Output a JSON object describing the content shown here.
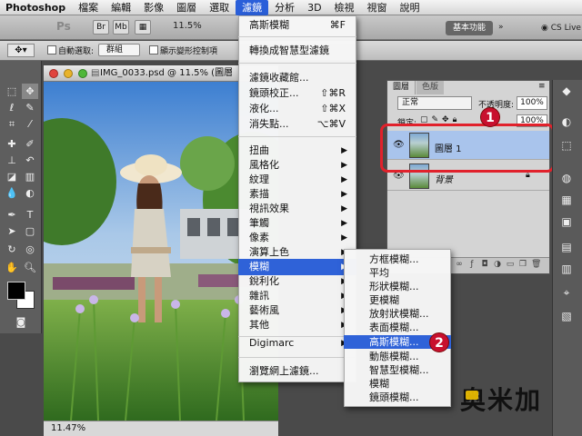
{
  "menubar": {
    "app_name": "Photoshop",
    "items": [
      "檔案",
      "編輯",
      "影像",
      "圖層",
      "選取",
      "濾鏡",
      "分析",
      "3D",
      "檢視",
      "視窗",
      "說明"
    ],
    "active": "濾鏡"
  },
  "appbar": {
    "ps_label": "Ps",
    "br_label": "Br",
    "mb_label": "Mb",
    "zoom": "11.5%",
    "workspace_label": "基本功能",
    "cslive_label": "CS Live"
  },
  "options": {
    "autoselect_label": "自動選取:",
    "group_value": "群組",
    "transform_label": "顯示變形控制項"
  },
  "document": {
    "title": "IMG_0033.psd @ 11.5% (圖層",
    "zoom_status": "11.47%"
  },
  "layers_panel": {
    "tabs": [
      "圖層",
      "色版"
    ],
    "blend_mode": "正常",
    "opacity_label": "不透明度:",
    "opacity_value": "100%",
    "lock_label": "鎖定:",
    "fill_value": "100%",
    "layers": [
      {
        "name": "圖層 1",
        "selected": true
      },
      {
        "name": "背景",
        "selected": false
      }
    ]
  },
  "filter_menu": {
    "top": [
      {
        "label": "高斯模糊",
        "shortcut": "⌘F"
      }
    ],
    "convert": "轉換成智慧型濾鏡",
    "group2": [
      {
        "label": "濾鏡收藏館...",
        "shortcut": ""
      },
      {
        "label": "鏡頭校正...",
        "shortcut": "⇧⌘R"
      },
      {
        "label": "液化...",
        "shortcut": "⇧⌘X"
      },
      {
        "label": "消失點...",
        "shortcut": "⌥⌘V"
      }
    ],
    "submenus": [
      "扭曲",
      "風格化",
      "紋理",
      "素描",
      "視訊效果",
      "筆觸",
      "像素",
      "演算上色",
      "模糊",
      "銳利化",
      "雜訊",
      "藝術風",
      "其他"
    ],
    "highlighted": "模糊",
    "digimarc": "Digimarc",
    "browse": "瀏覽網上濾鏡..."
  },
  "blur_submenu": {
    "items": [
      "方框模糊...",
      "平均",
      "形狀模糊...",
      "更模糊",
      "放射狀模糊...",
      "表面模糊...",
      "高斯模糊...",
      "動態模糊...",
      "智慧型模糊...",
      "模糊",
      "鏡頭模糊..."
    ],
    "highlighted": "高斯模糊..."
  },
  "annotations": {
    "badge1": "1",
    "badge2": "2"
  },
  "logo_text": "奥米加",
  "colors": {
    "highlight": "#2f62d8",
    "annotation_red": "#e1212b"
  }
}
